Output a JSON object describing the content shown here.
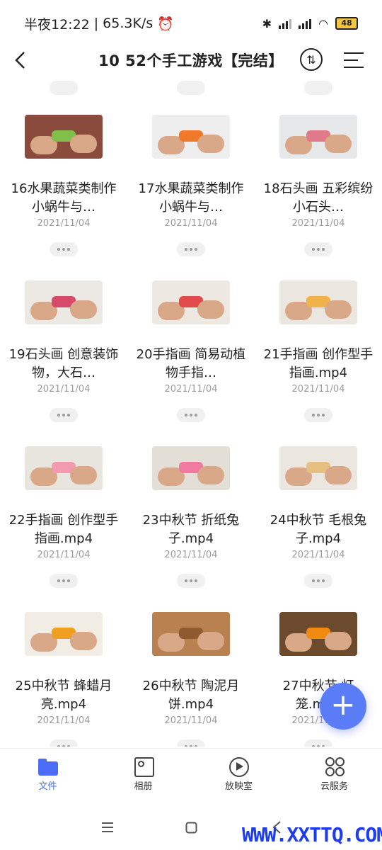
{
  "status_bar": {
    "time": "半夜12:22",
    "speed": "65.3K/s",
    "battery": "48"
  },
  "header": {
    "title": "10 52个手工游戏【完结】"
  },
  "files": [
    {
      "name": "16水果蔬菜类制作小蜗牛与…",
      "date": "2021/11/04",
      "thumb_bg": "#8a4b3d",
      "obj": "#7fbf4a"
    },
    {
      "name": "17水果蔬菜类制作小蜗牛与…",
      "date": "2021/11/04",
      "thumb_bg": "#eeeeee",
      "obj": "#f07a2a"
    },
    {
      "name": "18石头画  五彩缤纷小石头…",
      "date": "2021/11/04",
      "thumb_bg": "#e6e8ea",
      "obj": "#e07a8a"
    },
    {
      "name": "19石头画  创意装饰物，大石…",
      "date": "2021/11/04",
      "thumb_bg": "#ece9e4",
      "obj": "#d84a6a"
    },
    {
      "name": "20手指画 简易动植物手指…",
      "date": "2021/11/04",
      "thumb_bg": "#ede9e2",
      "obj": "#e34a4a"
    },
    {
      "name": "21手指画  创作型手指画.mp4",
      "date": "2021/11/04",
      "thumb_bg": "#ebe6df",
      "obj": "#f0b24a"
    },
    {
      "name": "22手指画  创作型手指画.mp4",
      "date": "2021/11/04",
      "thumb_bg": "#e8e5df",
      "obj": "#f29ab0"
    },
    {
      "name": "23中秋节 折纸兔子.mp4",
      "date": "2021/11/04",
      "thumb_bg": "#e4dfd6",
      "obj": "#f07aa0"
    },
    {
      "name": "24中秋节 毛根兔子.mp4",
      "date": "2021/11/04",
      "thumb_bg": "#ebe7e0",
      "obj": "#e5c080"
    },
    {
      "name": "25中秋节  蜂蜡月亮.mp4",
      "date": "2021/11/04",
      "thumb_bg": "#f1ede5",
      "obj": "#f0a020"
    },
    {
      "name": "26中秋节  陶泥月饼.mp4",
      "date": "2021/11/04",
      "thumb_bg": "#b9814f",
      "obj": "#8f5a30"
    },
    {
      "name": "27中秋节  灯笼.mp4",
      "date": "2021/11/04",
      "thumb_bg": "#6c4a2e",
      "obj": "#f08a10"
    }
  ],
  "fab": {
    "label": "+"
  },
  "bottom_nav": [
    {
      "label": "文件",
      "active": true
    },
    {
      "label": "相册",
      "active": false
    },
    {
      "label": "放映室",
      "active": false
    },
    {
      "label": "云服务",
      "active": false
    }
  ],
  "watermark": "WWW.XXTTQ.COM",
  "colors": {
    "accent": "#4a6cf7",
    "fab": "#5b7cf7",
    "date": "#9b9b9b"
  }
}
